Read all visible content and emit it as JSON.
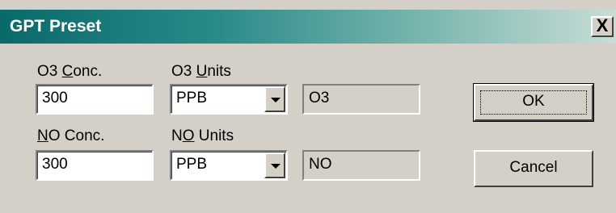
{
  "window": {
    "title": "GPT Preset",
    "close_label": "X"
  },
  "o3": {
    "conc_label_pre": "O3 ",
    "conc_label_u": "C",
    "conc_label_post": "onc.",
    "conc_value": "300",
    "units_label_pre": "O3 ",
    "units_label_u": "U",
    "units_label_post": "nits",
    "units_value": "PPB",
    "gas_name": "O3"
  },
  "no": {
    "conc_label_u": "N",
    "conc_label_post": "O Conc.",
    "conc_value": "300",
    "units_label_pre": "N",
    "units_label_u": "O",
    "units_label_post": " Units",
    "units_value": "PPB",
    "gas_name": "NO"
  },
  "buttons": {
    "ok": "OK",
    "cancel": "Cancel"
  }
}
